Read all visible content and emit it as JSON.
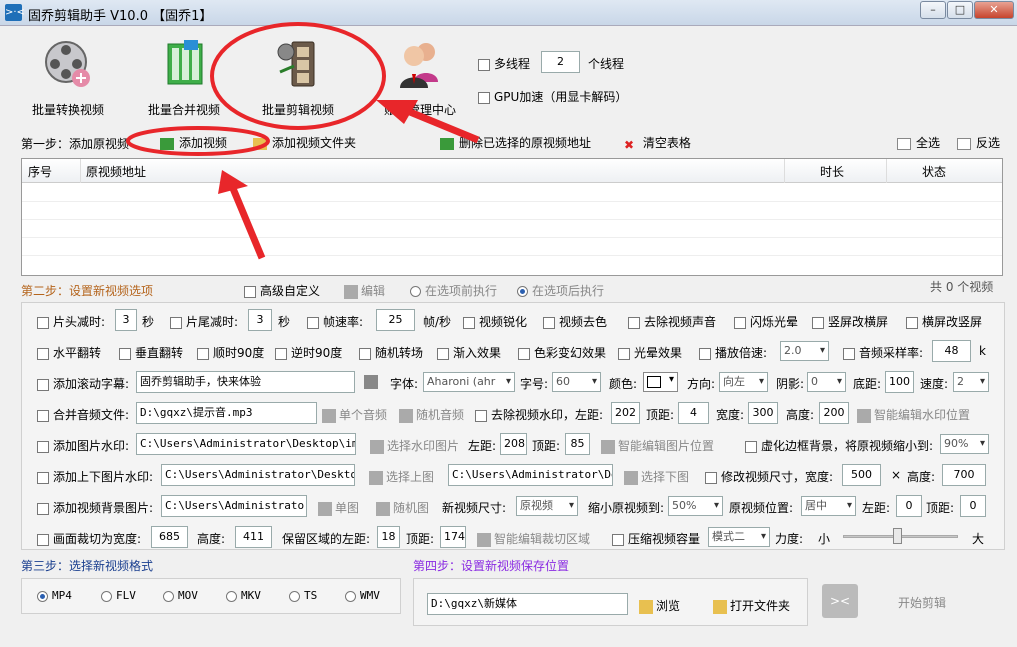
{
  "window": {
    "title": "固乔剪辑助手 V10.0  【固乔1】",
    "app_icon": ">·<"
  },
  "winbtns": {
    "min": "–",
    "max": "□",
    "close": "✕"
  },
  "top": {
    "btn1": "批量转换视频",
    "btn2": "批量合并视频",
    "btn3": "批量剪辑视频",
    "btn4": "账号管理中心",
    "multithread": "多线程",
    "thread_count": "2",
    "thread_unit": "个线程",
    "gpu": "GPU加速（用显卡解码）"
  },
  "step1": {
    "label": "第一步：添加原视频",
    "add_video": "添加视频",
    "add_folder": "添加视频文件夹",
    "delete_selected": "删除已选择的原视频地址",
    "clear_table": "清空表格",
    "select_all": "全选",
    "invert": "反选"
  },
  "table": {
    "col_no": "序号",
    "col_path": "原视频地址",
    "col_duration": "时长",
    "col_status": "状态",
    "count": "共 0 个视频"
  },
  "step2": {
    "label": "第二步：设置新视频选项",
    "advanced": "高级自定义",
    "edit": "编辑",
    "before": "在选项前执行",
    "after": "在选项后执行"
  },
  "row1": {
    "head_cut": "片头减时:",
    "head_val": "3",
    "sec1": "秒",
    "tail_cut": "片尾减时:",
    "tail_val": "3",
    "sec2": "秒",
    "fps": "帧速率:",
    "fps_val": "25",
    "fps_unit": "帧/秒",
    "sharpen": "视频锐化",
    "decolor": "视频去色",
    "mute": "去除视频声音",
    "flash": "闪烁光晕",
    "v2h": "竖屏改横屏",
    "h2v": "横屏改竖屏"
  },
  "row2": {
    "hflip": "水平翻转",
    "vflip": "垂直翻转",
    "r90": "顺时90度",
    "l90": "逆时90度",
    "random": "随机转场",
    "fadein": "渐入效果",
    "colorfx": "色彩变幻效果",
    "halo": "光晕效果",
    "speed": "播放倍速:",
    "speed_val": "2.0",
    "samplerate": "音频采样率:",
    "samplerate_val": "48",
    "samplerate_unit": "k"
  },
  "row3": {
    "scroll": "添加滚动字幕:",
    "scroll_text": "固乔剪辑助手，快来体验",
    "font": "字体:",
    "font_val": "Aharoni (ahr",
    "size": "字号:",
    "size_val": "60",
    "color": "颜色:",
    "dir": "方向:",
    "dir_val": "向左",
    "shadow": "阴影:",
    "shadow_val": "0",
    "bottom": "底距:",
    "bottom_val": "100",
    "speed": "速度:",
    "speed_val": "2"
  },
  "row4": {
    "audio": "合并音频文件:",
    "audio_path": "D:\\gqxz\\提示音.mp3",
    "single": "单个音频",
    "random": "随机音频",
    "remove_wm": "去除视频水印，左距:",
    "left_val": "202",
    "top": "顶距:",
    "top_val": "4",
    "width": "宽度:",
    "width_val": "300",
    "height": "高度:",
    "height_val": "200",
    "smart": "智能编辑水印位置"
  },
  "row5": {
    "imgwm": "添加图片水印:",
    "img_path": "C:\\Users\\Administrator\\Desktop\\img-q",
    "choose": "选择水印图片",
    "left": "左距:",
    "left_val": "208",
    "top": "顶距:",
    "top_val": "85",
    "smart": "智能编辑图片位置",
    "blur": "虚化边框背景，将原视频缩小到:",
    "blur_val": "90%"
  },
  "row6": {
    "updown": "添加上下图片水印:",
    "path1": "C:\\Users\\Administrator\\Desktop\\i",
    "choose_up": "选择上图",
    "path2": "C:\\Users\\Administrator\\Desk",
    "choose_down": "选择下图",
    "resize": "修改视频尺寸，宽度:",
    "w_val": "500",
    "times": "×",
    "h": "高度:",
    "h_val": "700"
  },
  "row7": {
    "bg": "添加视频背景图片:",
    "bg_path": "C:\\Users\\Administrator\\D",
    "single": "单图",
    "random": "随机图",
    "newsize": "新视频尺寸:",
    "newsize_val": "原视频",
    "shrink": "缩小原视频到:",
    "shrink_val": "50%",
    "pos": "原视频位置:",
    "pos_val": "居中",
    "left": "左距:",
    "left_val": "0",
    "top": "顶距:",
    "top_val": "0"
  },
  "row8": {
    "crop": "画面裁切为宽度:",
    "w_val": "685",
    "h": "高度:",
    "h_val": "411",
    "keep": "保留区域的左距:",
    "left_val": "18",
    "top": "顶距:",
    "top_val": "174",
    "smart": "智能编辑裁切区域",
    "compress": "压缩视频容量",
    "mode_val": "模式二",
    "force": "力度:",
    "small": "小",
    "big": "大"
  },
  "step3": {
    "label": "第三步：选择新视频格式",
    "formats": [
      "MP4",
      "FLV",
      "MOV",
      "MKV",
      "TS",
      "WMV"
    ]
  },
  "step4": {
    "label": "第四步：设置新视频保存位置",
    "path": "D:\\gqxz\\新媒体",
    "browse": "浏览",
    "open_folder": "打开文件夹",
    "start": "开始剪辑"
  },
  "colors": {
    "step_label": "#b5651d",
    "step4_label": "#8a2be2",
    "annotation": "#e8262a",
    "accent": "#2b5fb0"
  }
}
